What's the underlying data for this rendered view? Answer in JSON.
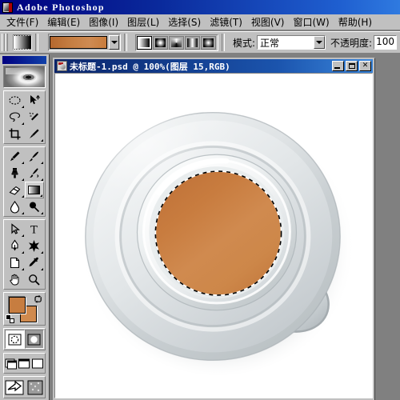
{
  "app": {
    "title": "Adobe Photoshop",
    "icon": "photoshop-app-icon"
  },
  "menubar": {
    "items": [
      {
        "label": "文件(F)",
        "name": "menu-file"
      },
      {
        "label": "编辑(E)",
        "name": "menu-edit"
      },
      {
        "label": "图像(I)",
        "name": "menu-image"
      },
      {
        "label": "图层(L)",
        "name": "menu-layer"
      },
      {
        "label": "选择(S)",
        "name": "menu-select"
      },
      {
        "label": "滤镜(T)",
        "name": "menu-filter"
      },
      {
        "label": "视图(V)",
        "name": "menu-view"
      },
      {
        "label": "窗口(W)",
        "name": "menu-window"
      },
      {
        "label": "帮助(H)",
        "name": "menu-help"
      }
    ]
  },
  "options_bar": {
    "tool": "gradient-tool",
    "gradient_preset_colors": [
      "#b5682f",
      "#c67f43",
      "#cf8b52",
      "#c87c3c"
    ],
    "gradient_types": [
      {
        "label": "linear-gradient",
        "selected": true
      },
      {
        "label": "radial-gradient",
        "selected": false
      },
      {
        "label": "angle-gradient",
        "selected": false
      },
      {
        "label": "reflected-gradient",
        "selected": false
      },
      {
        "label": "diamond-gradient",
        "selected": false
      }
    ],
    "mode_label": "模式:",
    "mode_value": "正常",
    "opacity_label": "不透明度:",
    "opacity_value": "100"
  },
  "toolbox": {
    "rows": [
      [
        {
          "icon": "marquee-tool-icon",
          "active": false
        },
        {
          "icon": "move-tool-icon",
          "active": false
        }
      ],
      [
        {
          "icon": "lasso-tool-icon",
          "active": false
        },
        {
          "icon": "magic-wand-tool-icon",
          "active": false
        }
      ],
      [
        {
          "icon": "crop-tool-icon",
          "active": false
        },
        {
          "icon": "slice-tool-icon",
          "active": false
        }
      ],
      [
        {
          "icon": "healing-brush-tool-icon",
          "active": false
        },
        {
          "icon": "paintbrush-tool-icon",
          "active": false
        }
      ],
      [
        {
          "icon": "clone-stamp-tool-icon",
          "active": false
        },
        {
          "icon": "history-brush-tool-icon",
          "active": false
        }
      ],
      [
        {
          "icon": "eraser-tool-icon",
          "active": false
        },
        {
          "icon": "gradient-tool-icon",
          "active": true
        }
      ],
      [
        {
          "icon": "blur-tool-icon",
          "active": false
        },
        {
          "icon": "dodge-tool-icon",
          "active": false
        }
      ],
      [
        {
          "icon": "path-selection-tool-icon",
          "active": false
        },
        {
          "icon": "type-tool-icon",
          "active": false
        }
      ],
      [
        {
          "icon": "pen-tool-icon",
          "active": false
        },
        {
          "icon": "custom-shape-tool-icon",
          "active": false
        }
      ],
      [
        {
          "icon": "notes-tool-icon",
          "active": false
        },
        {
          "icon": "eyedropper-tool-icon",
          "active": false
        }
      ],
      [
        {
          "icon": "hand-tool-icon",
          "active": false
        },
        {
          "icon": "zoom-tool-icon",
          "active": false
        }
      ]
    ],
    "foreground_color": "#c77d40",
    "background_color": "#d08a4e",
    "mask_modes": [
      {
        "icon": "standard-mask-mode-icon",
        "selected": false
      },
      {
        "icon": "quick-mask-mode-icon",
        "selected": true
      }
    ],
    "screen_modes": [
      {
        "icon": "standard-screen-mode-icon"
      },
      {
        "icon": "full-screen-menubar-mode-icon"
      },
      {
        "icon": "full-screen-mode-icon"
      }
    ],
    "jump_buttons": [
      {
        "icon": "jump-to-imageready-icon"
      },
      {
        "icon": "imageready-preview-icon"
      }
    ]
  },
  "document": {
    "title": "未标题-1.psd @ 100%(图层 15,RGB)",
    "buttons": [
      {
        "name": "minimize-button",
        "glyph": "minimize"
      },
      {
        "name": "maximize-button",
        "glyph": "maximize"
      },
      {
        "name": "close-button",
        "glyph": "✕"
      }
    ],
    "canvas": {
      "background": "#ffffff",
      "artwork": "coffee-cup-top-view-on-saucer",
      "liquid_color": "#c87c3f",
      "liquid_gradient": [
        "#c2763a",
        "#cf8a4f",
        "#c57b3e"
      ],
      "saucer_color": "#d5d9da",
      "cup_color": "#eef0f1",
      "selection": "elliptical-marching-ants-around-coffee-surface"
    }
  }
}
